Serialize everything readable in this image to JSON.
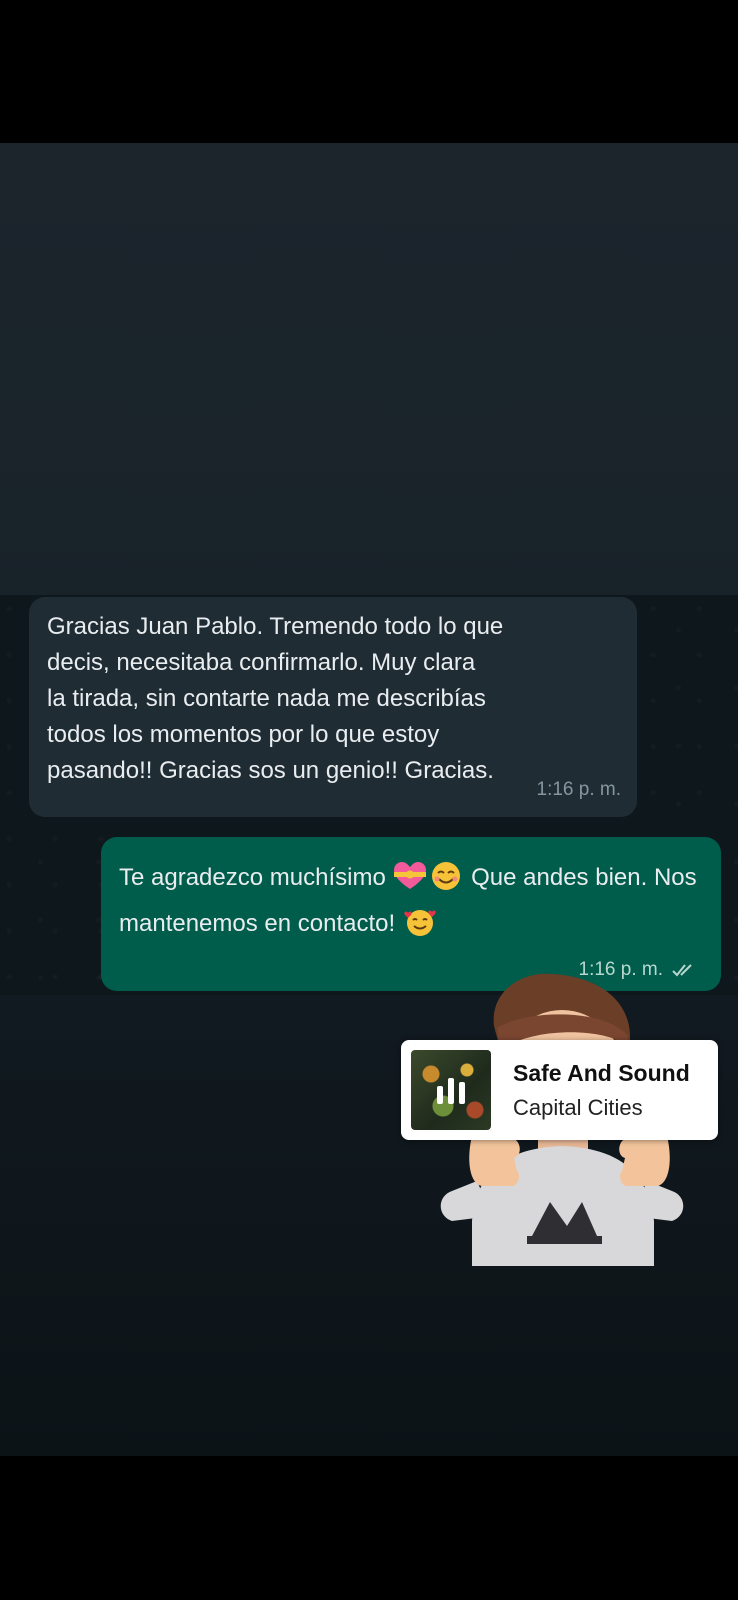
{
  "chat": {
    "incoming": {
      "text": "Gracias Juan Pablo. Tremendo todo lo que\ndecis, necesitaba confirmarlo. Muy clara\nla tirada, sin contarte nada me describías\ntodos los momentos por lo que estoy\npasando!! Gracias sos un genio!! Gracias.",
      "time": "1:16 p. m."
    },
    "outgoing": {
      "text_part1": "Te agradezco muchísimo ",
      "emoji_1": "heart-with-ribbon",
      "emoji_2": "smiling-face",
      "text_part2": " Que andes bien. Nos mantenemos en contacto! ",
      "emoji_3": "smiling-face-with-hearts",
      "time": "1:16 p. m.",
      "status_icon": "double-check-read"
    }
  },
  "music": {
    "title": "Safe And Sound",
    "artist": "Capital Cities",
    "state_icon": "equalizer-playing-icon"
  },
  "colors": {
    "incoming_bubble": "#1f2c34",
    "outgoing_bubble": "#005c4b",
    "sticker_bg": "#ffffff"
  }
}
